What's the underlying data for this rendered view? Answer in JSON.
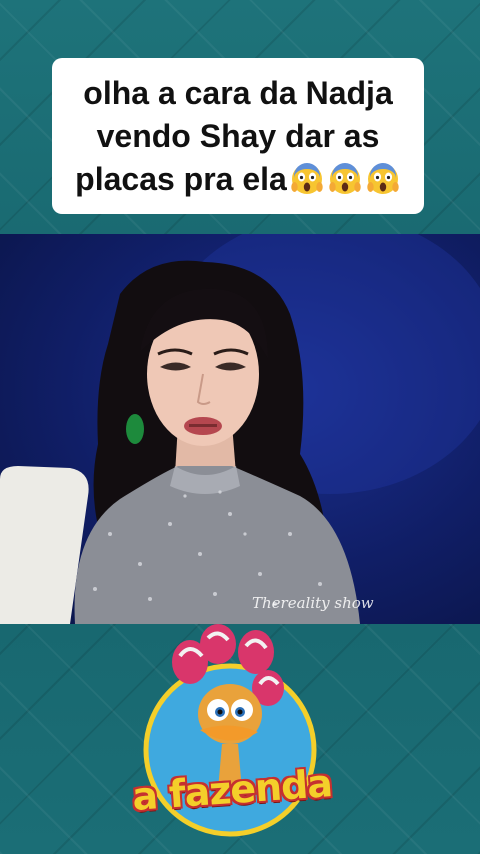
{
  "caption": {
    "text": "olha a cara da Nadja vendo Shay dar as placas pra ela",
    "emojis": [
      "face-screaming-in-fear-icon",
      "face-screaming-in-fear-icon",
      "face-screaming-in-fear-icon"
    ]
  },
  "video": {
    "watermark": "Thereality show"
  },
  "logo": {
    "text": "a fazenda"
  },
  "colors": {
    "background": "#1c6b73",
    "caption_bg": "#ffffff",
    "logo_yellow": "#f4cf2a",
    "logo_red": "#c53030",
    "studio_blue": "#142680"
  }
}
